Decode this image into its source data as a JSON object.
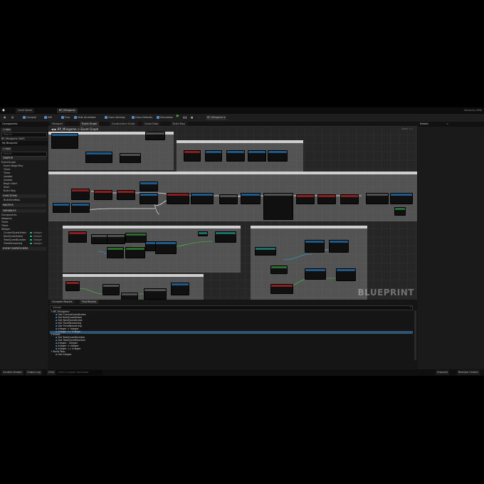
{
  "title_bar": {
    "tabs": [
      "Level Name",
      "BP_Minigame"
    ],
    "right_text": "Hierarchy  AMA"
  },
  "toolbar": {
    "buttons": [
      "Compile",
      "Diff",
      "Find",
      "Hide Unrelated",
      "Class Settings",
      "Class Defaults",
      "Simulation"
    ],
    "debug_object": "BP_Minigame"
  },
  "components_panel": {
    "title": "Components",
    "add_label": "+ Add",
    "search_placeholder": "Search",
    "items": [
      "BP_Minigame (Self)"
    ]
  },
  "my_blueprint_panel": {
    "title": "My Blueprint",
    "add_label": "+ Add",
    "search_placeholder": "Search",
    "graphs_header": "GRAPHS",
    "graphs": [
      "EventGraph",
      "Event BeginPlay",
      "Timer",
      "Timer",
      "Update",
      "Update",
      "Begin Start",
      "Start",
      "Build Map"
    ],
    "functions_header": "FUNCTIONS",
    "functions": [
      "BuildGridMap"
    ],
    "macros_header": "MACROS",
    "variables_header": "VARIABLES",
    "variables": [
      {
        "name": "Components",
        "type": ""
      },
      {
        "name": "Mapping",
        "type": ""
      },
      {
        "name": "Timer",
        "type": ""
      },
      {
        "name": "Timer",
        "type": ""
      },
      {
        "name": "Widget",
        "type": ""
      },
      {
        "name": "CurrentQuestIndex",
        "type": "Integer"
      },
      {
        "name": "NextQuestIndex",
        "type": "Integer"
      },
      {
        "name": "TotalQuestNumber",
        "type": "Integer"
      },
      {
        "name": "TimeRemaining",
        "type": "Integer"
      }
    ],
    "dispatchers_header": "EVENT DISPATCHERS"
  },
  "graph_tabs": [
    "Viewport",
    "Event Graph",
    "Construction Script",
    "Quest Data",
    "Build Map"
  ],
  "breadcrumb": "BP_Minigame  >  Event Graph",
  "zoom": "Zoom 1:1",
  "watermark": "BLUEPRINT",
  "details_panel": {
    "title": "Details"
  },
  "bottom_panel": {
    "tabs": [
      "Compiler Results",
      "Find Results"
    ],
    "search_value": "Integer",
    "results": [
      "BP_Minigame",
      "Get CurrentQuestIndex",
      "Set NextQuestIndex",
      "Get NextQuestIndex",
      "Set TimeRemaining",
      "Get TimeRemaining",
      "Integer + Integer",
      "Integer >= Integer",
      "Event",
      "Set TotalQuestNumber",
      "Get TotalQuestNumber",
      "Integer - Integer",
      "Integer < Integer",
      "Integer == Integer",
      "Build Map",
      "Get Integer"
    ],
    "selected_index": 7
  },
  "status_bar": {
    "buttons": [
      "Content Drawer",
      "Output Log",
      "Cmd"
    ],
    "cmd_placeholder": "Enter Console Command",
    "right": [
      "Unsaved",
      "Revision Control"
    ]
  },
  "colors": {
    "exec_node": "#1f5a8a",
    "event_node": "#8a1f1f",
    "pure_node": "#2e6b2e",
    "selection": "#2d5676",
    "play": "#3ec23e"
  }
}
